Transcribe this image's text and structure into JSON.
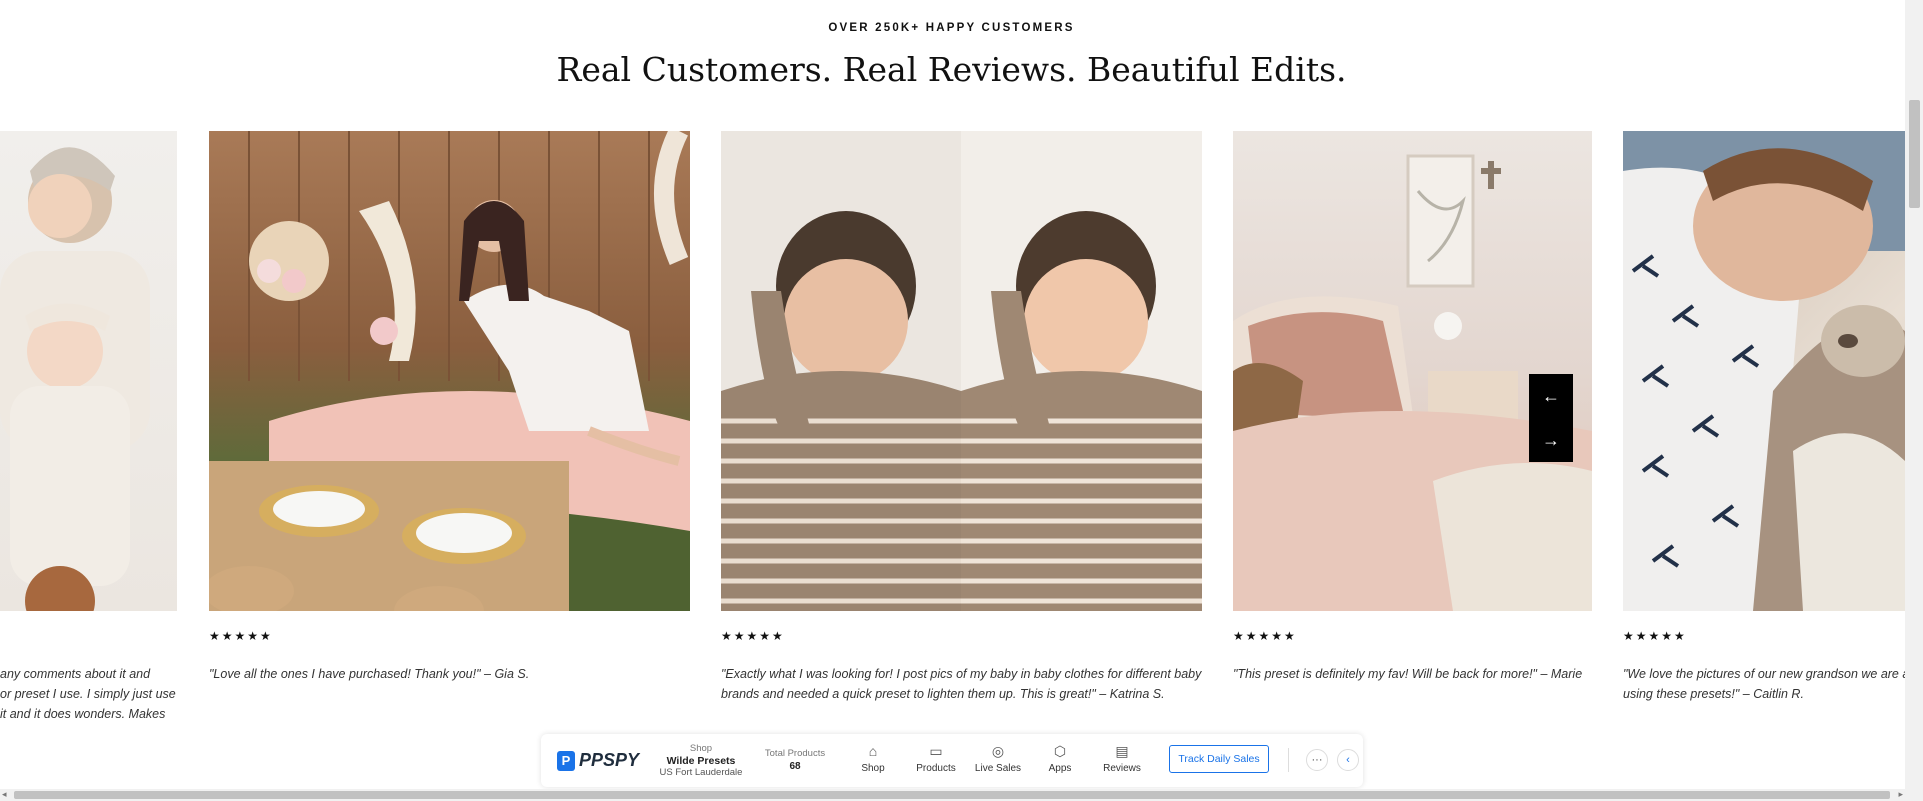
{
  "section": {
    "eyebrow": "OVER 250K+ HAPPY CUSTOMERS",
    "title": "Real Customers. Real Reviews. Beautiful Edits."
  },
  "reviews": [
    {
      "stars": "★★★★★",
      "lines": [
        "any comments about it and",
        "or preset I use. I simply just use",
        "it and it does wonders. Makes"
      ]
    },
    {
      "stars": "★★★★★",
      "lines": [
        "\"Love all the ones I have purchased! Thank you!\" – Gia S."
      ]
    },
    {
      "stars": "★★★★★",
      "lines": [
        "\"Exactly what I was looking for! I post pics of my baby in baby clothes for different baby",
        "brands and needed a quick preset to lighten them up. This is great!\" – Katrina S."
      ]
    },
    {
      "stars": "★★★★★",
      "lines": [
        "\"This preset is definitely my fav! Will be back for more!\" – Marie"
      ]
    },
    {
      "stars": "★★★★★",
      "lines": [
        "\"We love the pictures of our new grandson we are a",
        "using these presets!\" – Caitlin R."
      ]
    }
  ],
  "carousel": {
    "prev_icon": "←",
    "next_icon": "→"
  },
  "ppspy": {
    "logo_mark": "P",
    "logo_text": "PPSPY",
    "shop_label": "Shop",
    "shop_name": "Wilde Presets",
    "shop_location": "US Fort Lauderdale",
    "total_label": "Total Products",
    "total_value": "68",
    "nav": [
      {
        "icon": "⌂",
        "label": "Shop"
      },
      {
        "icon": "▭",
        "label": "Products"
      },
      {
        "icon": "◎",
        "label": "Live Sales"
      },
      {
        "icon": "⬡",
        "label": "Apps"
      },
      {
        "icon": "▤",
        "label": "Reviews"
      }
    ],
    "track_button": "Track Daily Sales",
    "more_icon": "···",
    "collapse_icon": "‹"
  },
  "scroll": {
    "left_arrow": "◂",
    "right_arrow": "▸"
  }
}
